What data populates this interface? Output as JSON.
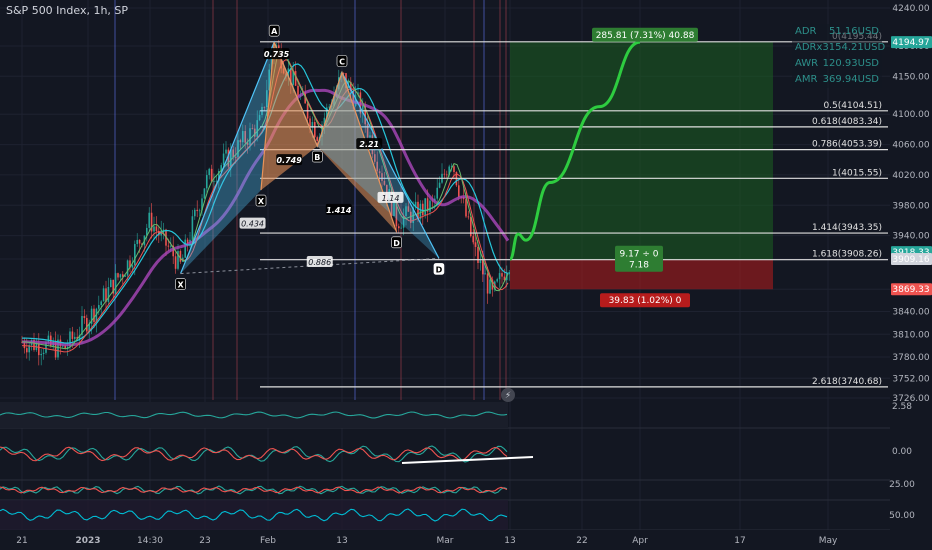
{
  "title": "S&P 500 Index, 1h, SP",
  "colors": {
    "background": "#131722",
    "bull": "#26a69a",
    "bear": "#ef5350",
    "harmonic_orange": "#e8935a",
    "harmonic_blue": "#4fc3f7",
    "profit": "#1b5e20",
    "loss": "#b71c1c",
    "grid": "#1e2230"
  },
  "info_box": [
    {
      "label": "ADR",
      "value": "51.16USD"
    },
    {
      "label": "ADRx3",
      "value": "154.21USD"
    },
    {
      "label": "AWR",
      "value": "120.93USD"
    },
    {
      "label": "AMR",
      "value": "369.94USD"
    }
  ],
  "chart_data": {
    "type": "line",
    "title": "S&P 500 Index, 1h, SP",
    "ylim": [
      3726,
      4240
    ],
    "y_ticks": [
      "4240.00",
      "4190.00",
      "4150.00",
      "4100.00",
      "4060.00",
      "4020.00",
      "3980.00",
      "3940.00",
      "3909.16",
      "3869.33",
      "3840.00",
      "3810.00",
      "3780.00",
      "3752.00",
      "3726.00"
    ],
    "x_ticks": [
      "21",
      "2023",
      "14:30",
      "23",
      "Feb",
      "13",
      "Mar",
      "13",
      "22",
      "Apr",
      "17",
      "May"
    ],
    "price_path": {
      "x": [
        "Dec 21",
        "Dec 28",
        "2023",
        "Jan 9",
        "14:30",
        "Jan 19",
        "Jan 23",
        "Jan 31",
        "Feb 2",
        "Feb 9",
        "Feb 13",
        "Feb 16",
        "Feb 22",
        "Feb 28",
        "Mar 3",
        "Mar 7",
        "Mar 10",
        "Mar 13"
      ],
      "y": [
        3800,
        3790,
        3830,
        3900,
        3960,
        3900,
        4010,
        4090,
        4195,
        4075,
        4150,
        4110,
        3960,
        3980,
        4045,
        3920,
        3860,
        3909
      ]
    },
    "projection": {
      "x": [
        "Mar 13",
        "Mar 14",
        "Mar 15",
        "Mar 18",
        "Mar 25",
        "Apr 1"
      ],
      "y": [
        3909,
        3942,
        3934,
        4010,
        4110,
        4195
      ]
    },
    "harmonic_points": [
      {
        "label": "X",
        "x": "Jan 19",
        "y": 3890
      },
      {
        "label": "A",
        "x": "Feb 2",
        "y": 4195
      },
      {
        "label": "X",
        "x": "Jan 31",
        "y": 4000
      },
      {
        "label": "B",
        "x": "Feb 9",
        "y": 4058
      },
      {
        "label": "C",
        "x": "Feb 13",
        "y": 4155
      },
      {
        "label": "D",
        "x": "Feb 22",
        "y": 3945
      },
      {
        "label": "D",
        "x": "Mar 1",
        "y": 3910
      }
    ],
    "harmonic_ratios": [
      "0.735",
      "0.749",
      "2.21",
      "1.414",
      "0.434",
      "0.886",
      "1.14"
    ],
    "fib_levels": [
      {
        "label": "0(4195.44)",
        "y": 4195.44
      },
      {
        "label": "0.5(4104.51)",
        "y": 4104.51
      },
      {
        "label": "0.618(4083.34)",
        "y": 4083.34
      },
      {
        "label": "0.786(4053.39)",
        "y": 4053.39
      },
      {
        "label": "1(4015.55)",
        "y": 4015.55
      },
      {
        "label": "1.414(3943.35)",
        "y": 3943.35
      },
      {
        "label": "1.618(3908.26)",
        "y": 3908.26
      },
      {
        "label": "2.618(3740.68)",
        "y": 3740.68
      }
    ],
    "position": {
      "target_label": "285.81 (7.31%) 40.88",
      "stop_label": "39.83 (1.02%) 0",
      "ratio_label": [
        "9.17 ÷ 0",
        "7.18"
      ]
    },
    "price_badges": [
      {
        "label": "4194.97",
        "y": 4194.97,
        "color": "#26a69a"
      },
      {
        "label": "3918.33",
        "y": 3918.33,
        "color": "#26a69a"
      },
      {
        "label": "3909.16",
        "y": 3909.16,
        "color": "#d1d4dc"
      },
      {
        "label": "3869.33",
        "y": 3869.33,
        "color": "#ef5350"
      }
    ],
    "indicator_ticks": [
      "2.58",
      "0.00",
      "25.00",
      "50.00"
    ]
  }
}
